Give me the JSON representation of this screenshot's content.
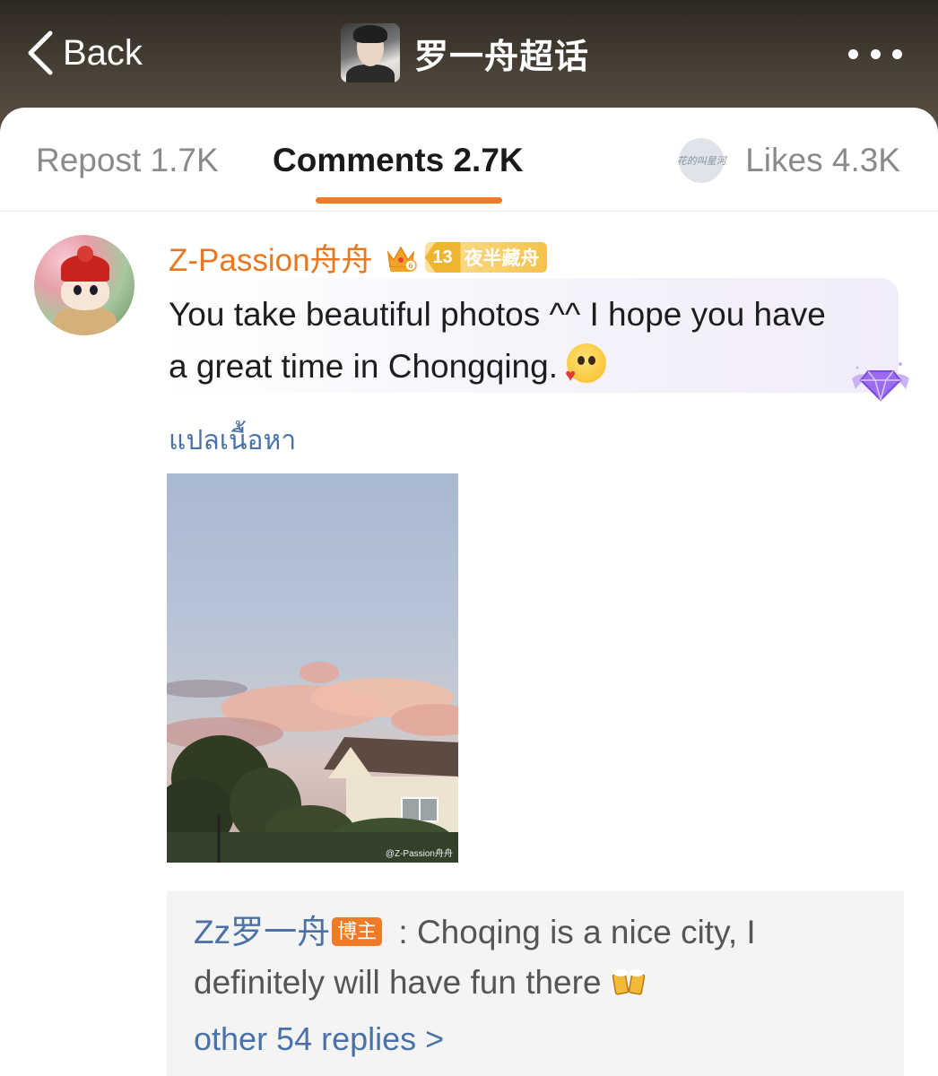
{
  "header": {
    "back_label": "Back",
    "title": "罗一舟超话"
  },
  "tabs": {
    "repost": "Repost 1.7K",
    "comments": "Comments 2.7K",
    "likes": "Likes 4.3K",
    "likes_avatar_text": "花的叫星河",
    "active": "comments"
  },
  "comment": {
    "username": "Z-Passion舟舟",
    "fan_level": "13",
    "fan_badge": "夜半藏舟",
    "text": "You take beautiful photos ^^ I hope you have a great time in Chongqing.",
    "translate_label": "แปลเนื้อหา",
    "photo_watermark": "@Z-Passion舟舟"
  },
  "reply": {
    "username": "Zz罗一舟",
    "role_badge": "博主",
    "text": " : Choqing is a nice city, I definitely will have fun there",
    "more_replies": "other 54 replies >"
  },
  "colors": {
    "accent": "#f07a26",
    "username": "#e8771f",
    "link": "#4a72a6"
  }
}
